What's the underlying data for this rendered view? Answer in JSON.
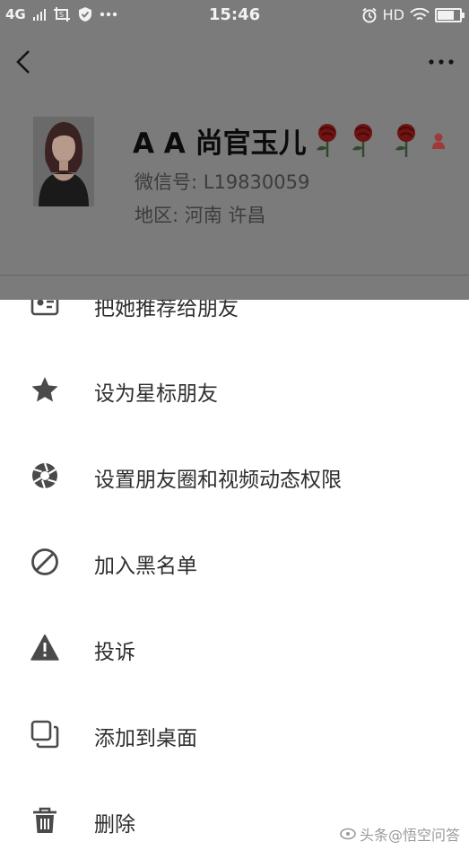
{
  "status_bar": {
    "network": "4G",
    "time": "15:46",
    "hd_label": "HD",
    "battery_level": 0.75
  },
  "profile": {
    "name": "A A 尚官玉儿",
    "wechat_id": "微信号: L19830059",
    "region": "地区: 河南  许昌"
  },
  "menu": {
    "items": [
      {
        "label": "把她推荐给朋友",
        "icon": "share-card-icon"
      },
      {
        "label": "设为星标朋友",
        "icon": "star-icon"
      },
      {
        "label": "设置朋友圈和视频动态权限",
        "icon": "aperture-icon"
      },
      {
        "label": "加入黑名单",
        "icon": "block-icon"
      },
      {
        "label": "投诉",
        "icon": "warning-icon"
      },
      {
        "label": "添加到桌面",
        "icon": "add-to-desktop-icon"
      },
      {
        "label": "删除",
        "icon": "trash-icon"
      }
    ]
  },
  "watermark": "头条@悟空问答",
  "colors": {
    "overlay": "#7b7b7b",
    "sheet": "#ffffff",
    "icon": "#4a4a4a",
    "text": "#2e2e2e",
    "rose": "#7a1414"
  }
}
